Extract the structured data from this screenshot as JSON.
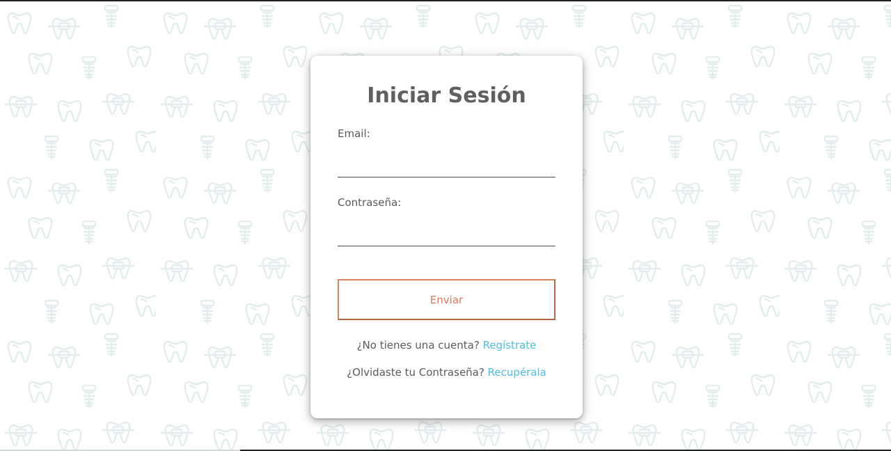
{
  "login": {
    "title": "Iniciar Sesión",
    "email_label": "Email:",
    "email_value": "",
    "password_label": "Contraseña:",
    "password_value": "",
    "submit_label": "Enviar",
    "register_prompt": "¿No tienes una cuenta?",
    "register_link": "Regístrate",
    "recover_prompt": "¿Olvidaste tu Contraseña?",
    "recover_link": "Recupérala"
  },
  "background": {
    "pattern_icons": [
      "tooth-icon",
      "braces-tooth-icon",
      "dental-implant-icon"
    ]
  },
  "colors": {
    "page_background": "#ffffff",
    "pattern_line": "#e6efef",
    "title_text": "#5f5f5f",
    "button_border": "#d8835c",
    "button_text": "#e0785a",
    "link": "#4bbfdf"
  }
}
